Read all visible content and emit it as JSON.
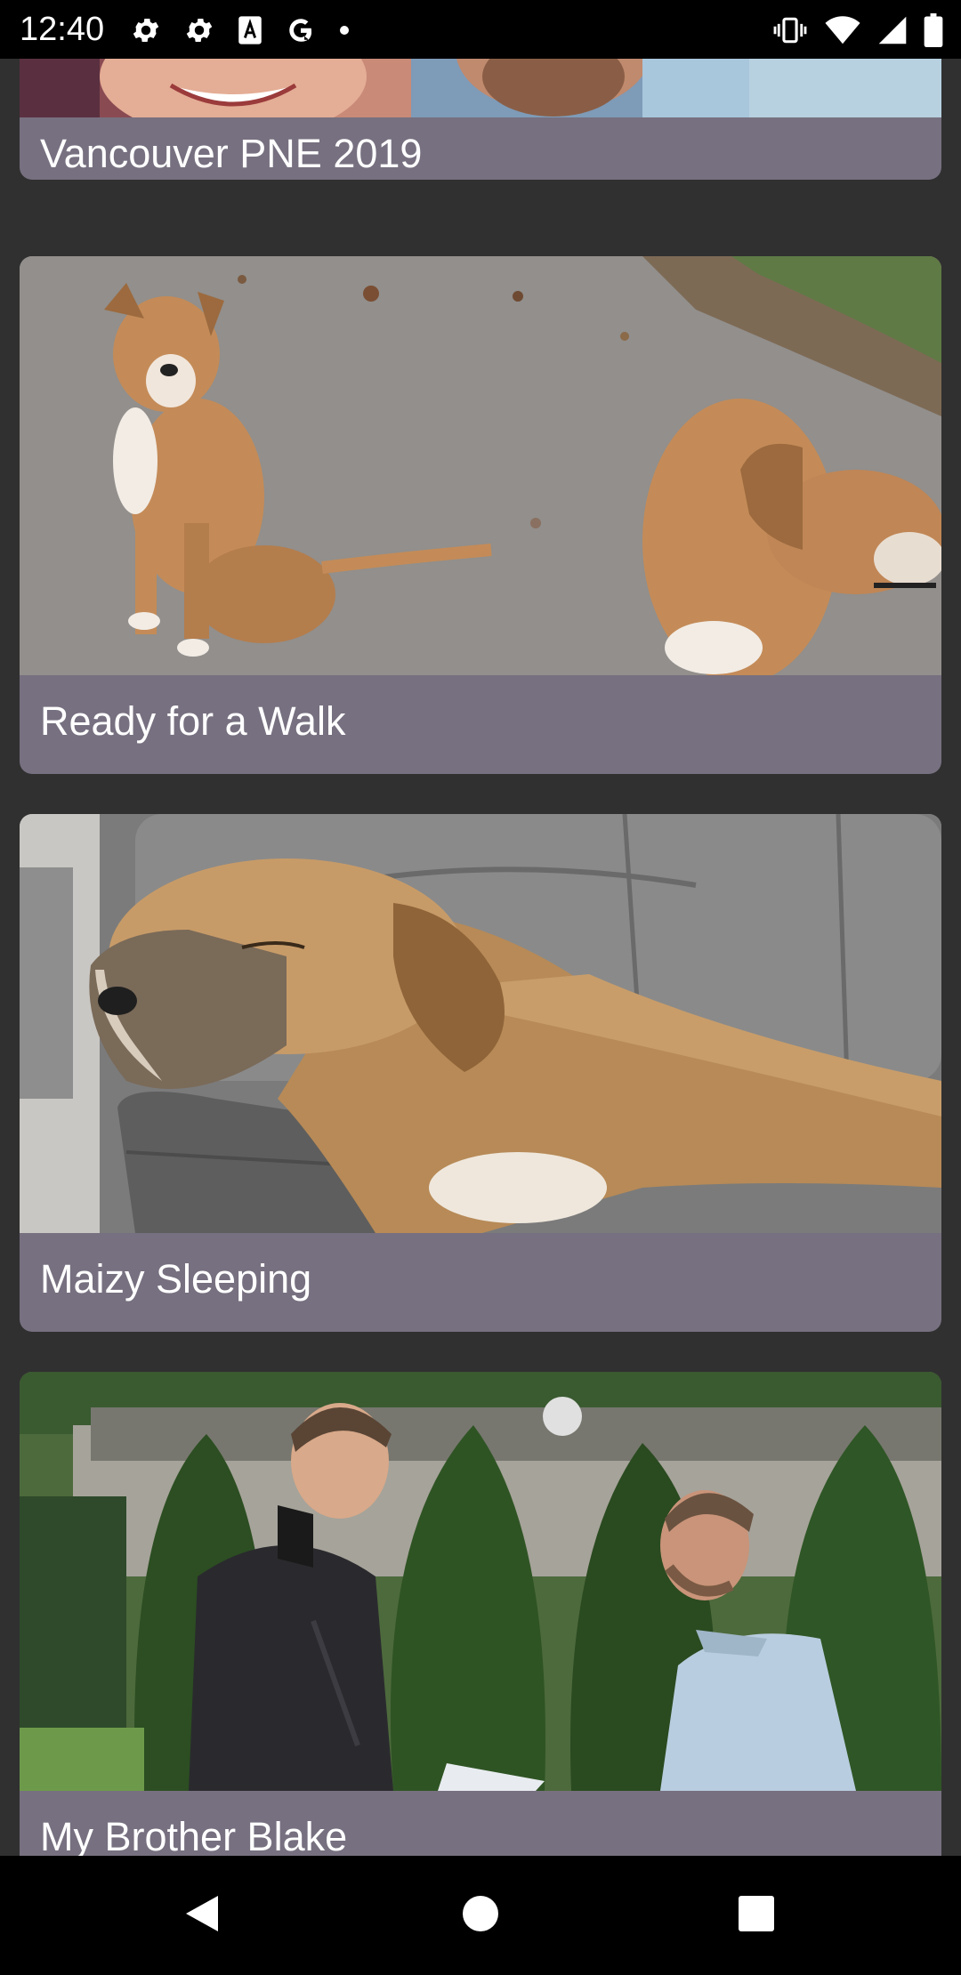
{
  "status_bar": {
    "time": "12:40",
    "left_icons": [
      "gear-icon",
      "gear-icon",
      "translate-icon",
      "google-icon",
      "dot-icon"
    ],
    "right_icons": [
      "vibrate-icon",
      "wifi-icon",
      "cell-signal-icon",
      "battery-icon"
    ]
  },
  "cards": [
    {
      "title": "Vancouver PNE 2019",
      "photo": "couple-smiling-photo"
    },
    {
      "title": "Ready for a Walk",
      "photo": "two-dogs-on-path-photo"
    },
    {
      "title": "Maizy Sleeping",
      "photo": "dog-sleeping-on-couch-photo"
    },
    {
      "title": "My Brother Blake",
      "photo": "two-men-in-garden-photo"
    }
  ],
  "nav_bar": {
    "buttons": [
      "back-icon",
      "home-icon",
      "recents-icon"
    ]
  },
  "colors": {
    "background": "#303030",
    "card": "#777080",
    "bars": "#000000",
    "text": "#ffffff"
  }
}
